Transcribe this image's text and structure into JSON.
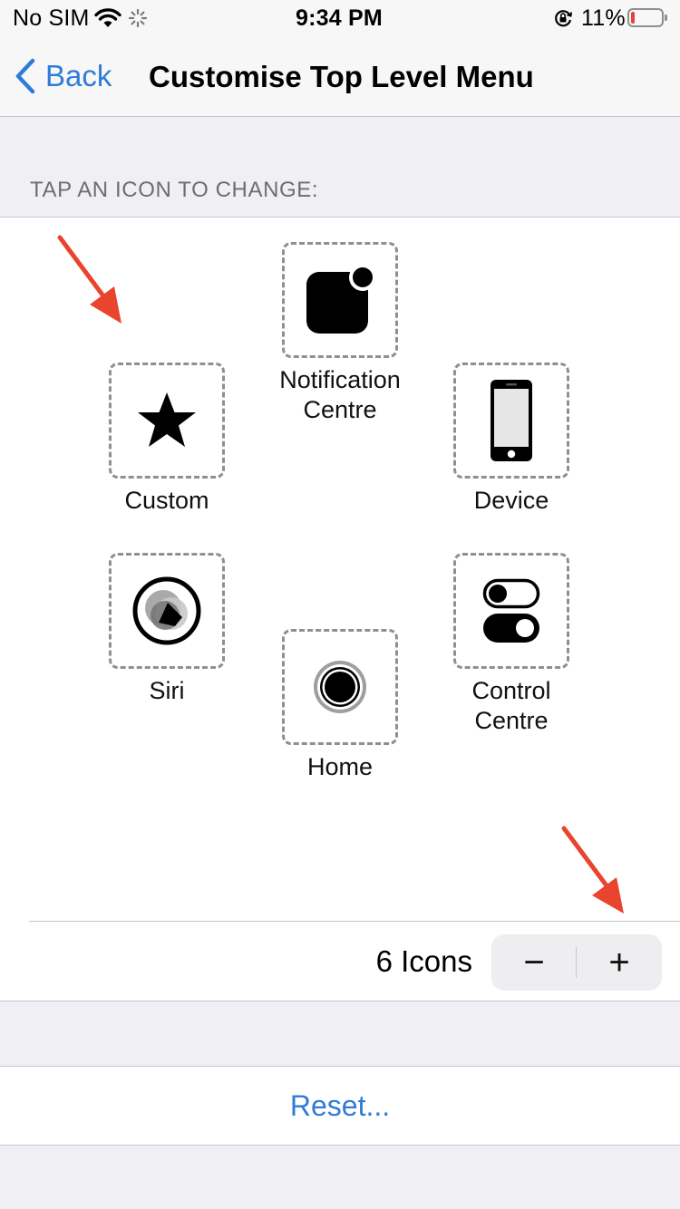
{
  "status_bar": {
    "carrier": "No SIM",
    "time": "9:34 PM",
    "battery_percent": "11%",
    "battery_level": 0.11,
    "battery_color": "#e3443b"
  },
  "nav": {
    "back_label": "Back",
    "title": "Customise Top Level Menu"
  },
  "section_header": "TAP AN ICON TO CHANGE:",
  "icons": {
    "notification_centre": {
      "label": "Notification\nCentre",
      "icon": "notification-centre-icon"
    },
    "custom": {
      "label": "Custom",
      "icon": "star-icon"
    },
    "device": {
      "label": "Device",
      "icon": "iphone-icon"
    },
    "siri": {
      "label": "Siri",
      "icon": "siri-icon"
    },
    "home": {
      "label": "Home",
      "icon": "home-button-icon"
    },
    "control_centre": {
      "label": "Control\nCentre",
      "icon": "toggles-icon"
    }
  },
  "icon_count": {
    "label": "6 Icons",
    "decrement": "−",
    "increment": "+"
  },
  "reset_label": "Reset...",
  "colors": {
    "accent": "#2f7bd8",
    "annotation_arrow": "#e8442e"
  }
}
